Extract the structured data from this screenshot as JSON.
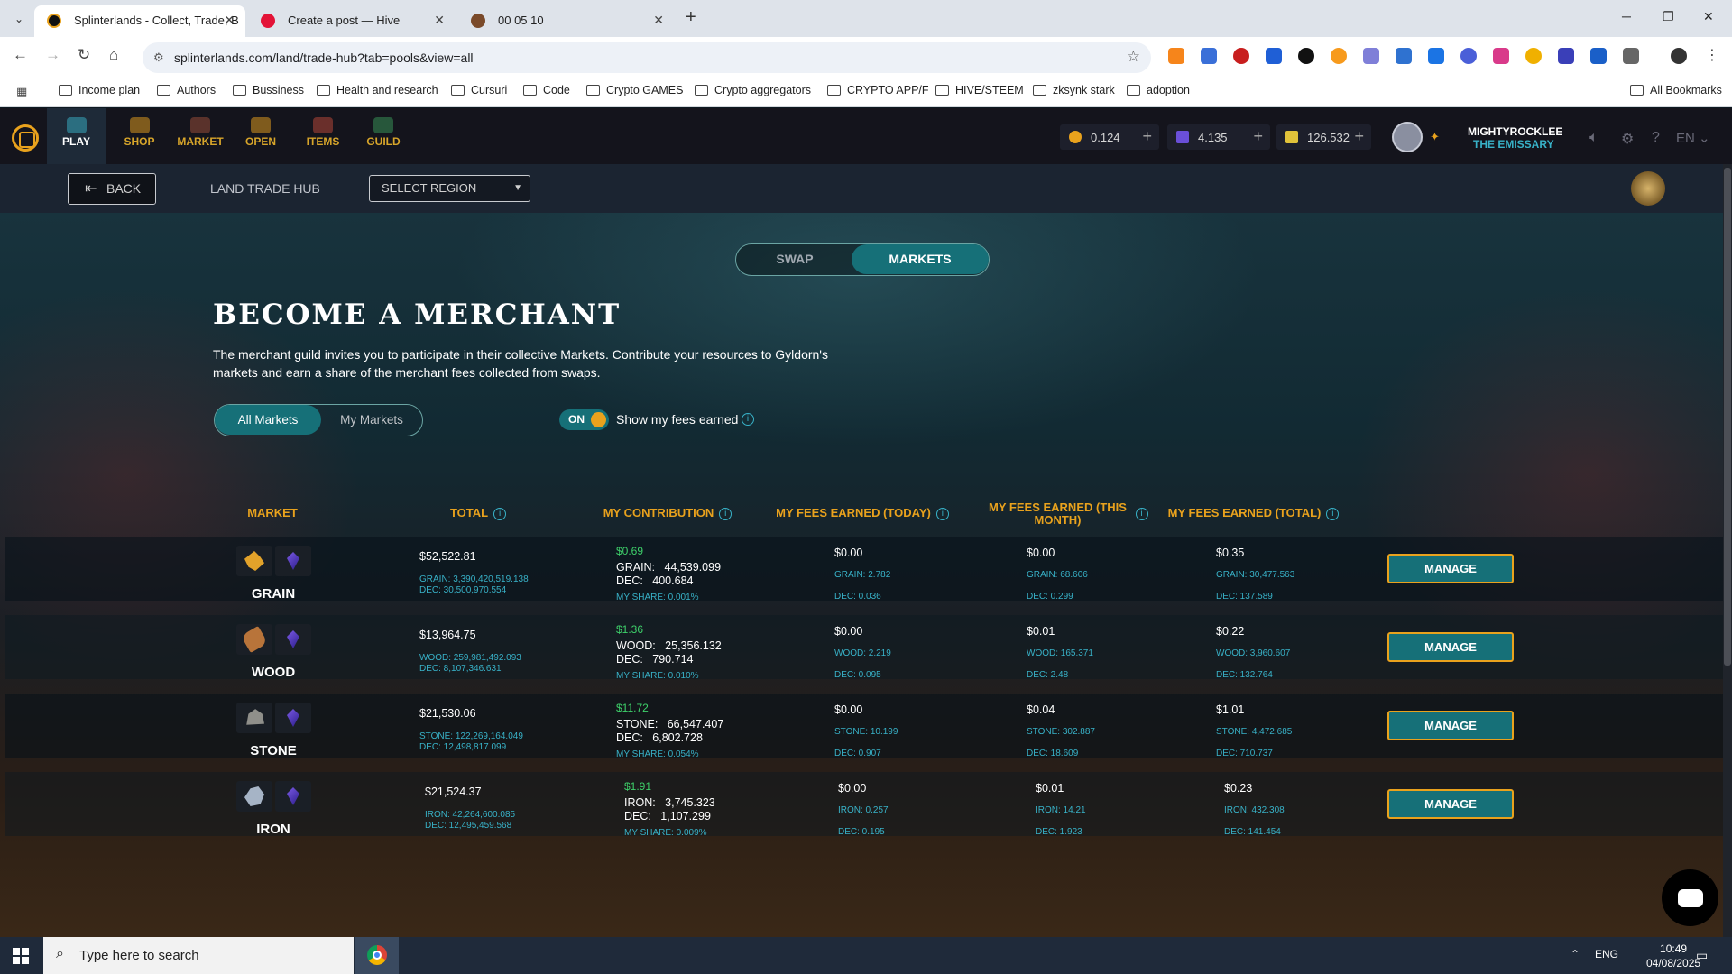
{
  "browser": {
    "tabs": [
      {
        "title": "Splinterlands - Collect, Trade, B",
        "active": true
      },
      {
        "title": "Create a post — Hive",
        "active": false
      },
      {
        "title": "00 05 10",
        "active": false
      }
    ],
    "url": "splinterlands.com/land/trade-hub?tab=pools&view=all",
    "bookmarks": [
      "Income plan",
      "Authors",
      "Bussiness",
      "Health and research",
      "Cursuri",
      "Code",
      "Crypto GAMES",
      "Crypto aggregators",
      "CRYPTO APP/F",
      "HIVE/STEEM",
      "zksynk stark",
      "adoption"
    ],
    "all_bookmarks": "All Bookmarks"
  },
  "nav": {
    "items": [
      "PLAY",
      "SHOP",
      "MARKET",
      "OPEN",
      "ITEMS",
      "GUILD"
    ],
    "currencies": [
      {
        "value": "0.124",
        "color": "#e9a21d"
      },
      {
        "value": "4.135",
        "color": "#6a4fd8"
      },
      {
        "value": "126.532",
        "color": "#e0c23a"
      }
    ],
    "username": "MIGHTYROCKLEE",
    "user_title": "THE EMISSARY",
    "language": "EN"
  },
  "subnav": {
    "back": "BACK",
    "title": "LAND TRADE HUB",
    "region_select": "SELECT REGION"
  },
  "main": {
    "tabs": [
      "SWAP",
      "MARKETS"
    ],
    "heading": "BECOME A MERCHANT",
    "description": "The merchant guild invites you to participate in their collective Markets. Contribute your resources to Gyldorn's markets and earn a share of the merchant fees collected from swaps.",
    "filters": [
      "All Markets",
      "My Markets"
    ],
    "fees_toggle": "ON",
    "fees_label": "Show my fees earned"
  },
  "table": {
    "headers": [
      "MARKET",
      "TOTAL",
      "MY CONTRIBUTION",
      "MY FEES EARNED (TODAY)",
      "MY FEES EARNED (THIS MONTH)",
      "MY FEES EARNED (TOTAL)"
    ],
    "manage_label": "MANAGE",
    "rows": [
      {
        "name": "GRAIN",
        "total": "$52,522.81",
        "total_res": "GRAIN: 3,390,420,519.138",
        "total_dec": "DEC: 30,500,970.554",
        "contrib_usd": "$0.69",
        "contrib_res": "GRAIN:   44,539.099",
        "contrib_dec": "DEC:   400.684",
        "share": "MY SHARE: 0.001%",
        "today_usd": "$0.00",
        "today_res": "GRAIN: 2.782",
        "today_dec": "DEC: 0.036",
        "month_usd": "$0.00",
        "month_res": "GRAIN: 68.606",
        "month_dec": "DEC: 0.299",
        "all_usd": "$0.35",
        "all_res": "GRAIN: 30,477.563",
        "all_dec": "DEC: 137.589"
      },
      {
        "name": "WOOD",
        "total": "$13,964.75",
        "total_res": "WOOD: 259,981,492.093",
        "total_dec": "DEC: 8,107,346.631",
        "contrib_usd": "$1.36",
        "contrib_res": "WOOD:   25,356.132",
        "contrib_dec": "DEC:   790.714",
        "share": "MY SHARE: 0.010%",
        "today_usd": "$0.00",
        "today_res": "WOOD: 2.219",
        "today_dec": "DEC: 0.095",
        "month_usd": "$0.01",
        "month_res": "WOOD: 165.371",
        "month_dec": "DEC: 2.48",
        "all_usd": "$0.22",
        "all_res": "WOOD: 3,960.607",
        "all_dec": "DEC: 132.764"
      },
      {
        "name": "STONE",
        "total": "$21,530.06",
        "total_res": "STONE: 122,269,164.049",
        "total_dec": "DEC: 12,498,817.099",
        "contrib_usd": "$11.72",
        "contrib_res": "STONE:   66,547.407",
        "contrib_dec": "DEC:   6,802.728",
        "share": "MY SHARE: 0.054%",
        "today_usd": "$0.00",
        "today_res": "STONE: 10.199",
        "today_dec": "DEC: 0.907",
        "month_usd": "$0.04",
        "month_res": "STONE: 302.887",
        "month_dec": "DEC: 18.609",
        "all_usd": "$1.01",
        "all_res": "STONE: 4,472.685",
        "all_dec": "DEC: 710.737"
      },
      {
        "name": "IRON",
        "total": "$21,524.37",
        "total_res": "IRON: 42,264,600.085",
        "total_dec": "DEC: 12,495,459.568",
        "contrib_usd": "$1.91",
        "contrib_res": "IRON:   3,745.323",
        "contrib_dec": "DEC:   1,107.299",
        "share": "MY SHARE: 0.009%",
        "today_usd": "$0.00",
        "today_res": "IRON: 0.257",
        "today_dec": "DEC: 0.195",
        "month_usd": "$0.01",
        "month_res": "IRON: 14.21",
        "month_dec": "DEC: 1.923",
        "all_usd": "$0.23",
        "all_res": "IRON: 432.308",
        "all_dec": "DEC: 141.454"
      }
    ]
  },
  "taskbar": {
    "search_placeholder": "Type here to search",
    "lang": "ENG",
    "time": "10:49",
    "date": "04/08/2025"
  },
  "colors": {
    "accent_teal": "#167078",
    "gold": "#e9a21d",
    "cyan": "#38b2c8",
    "green": "#3ed06a"
  }
}
